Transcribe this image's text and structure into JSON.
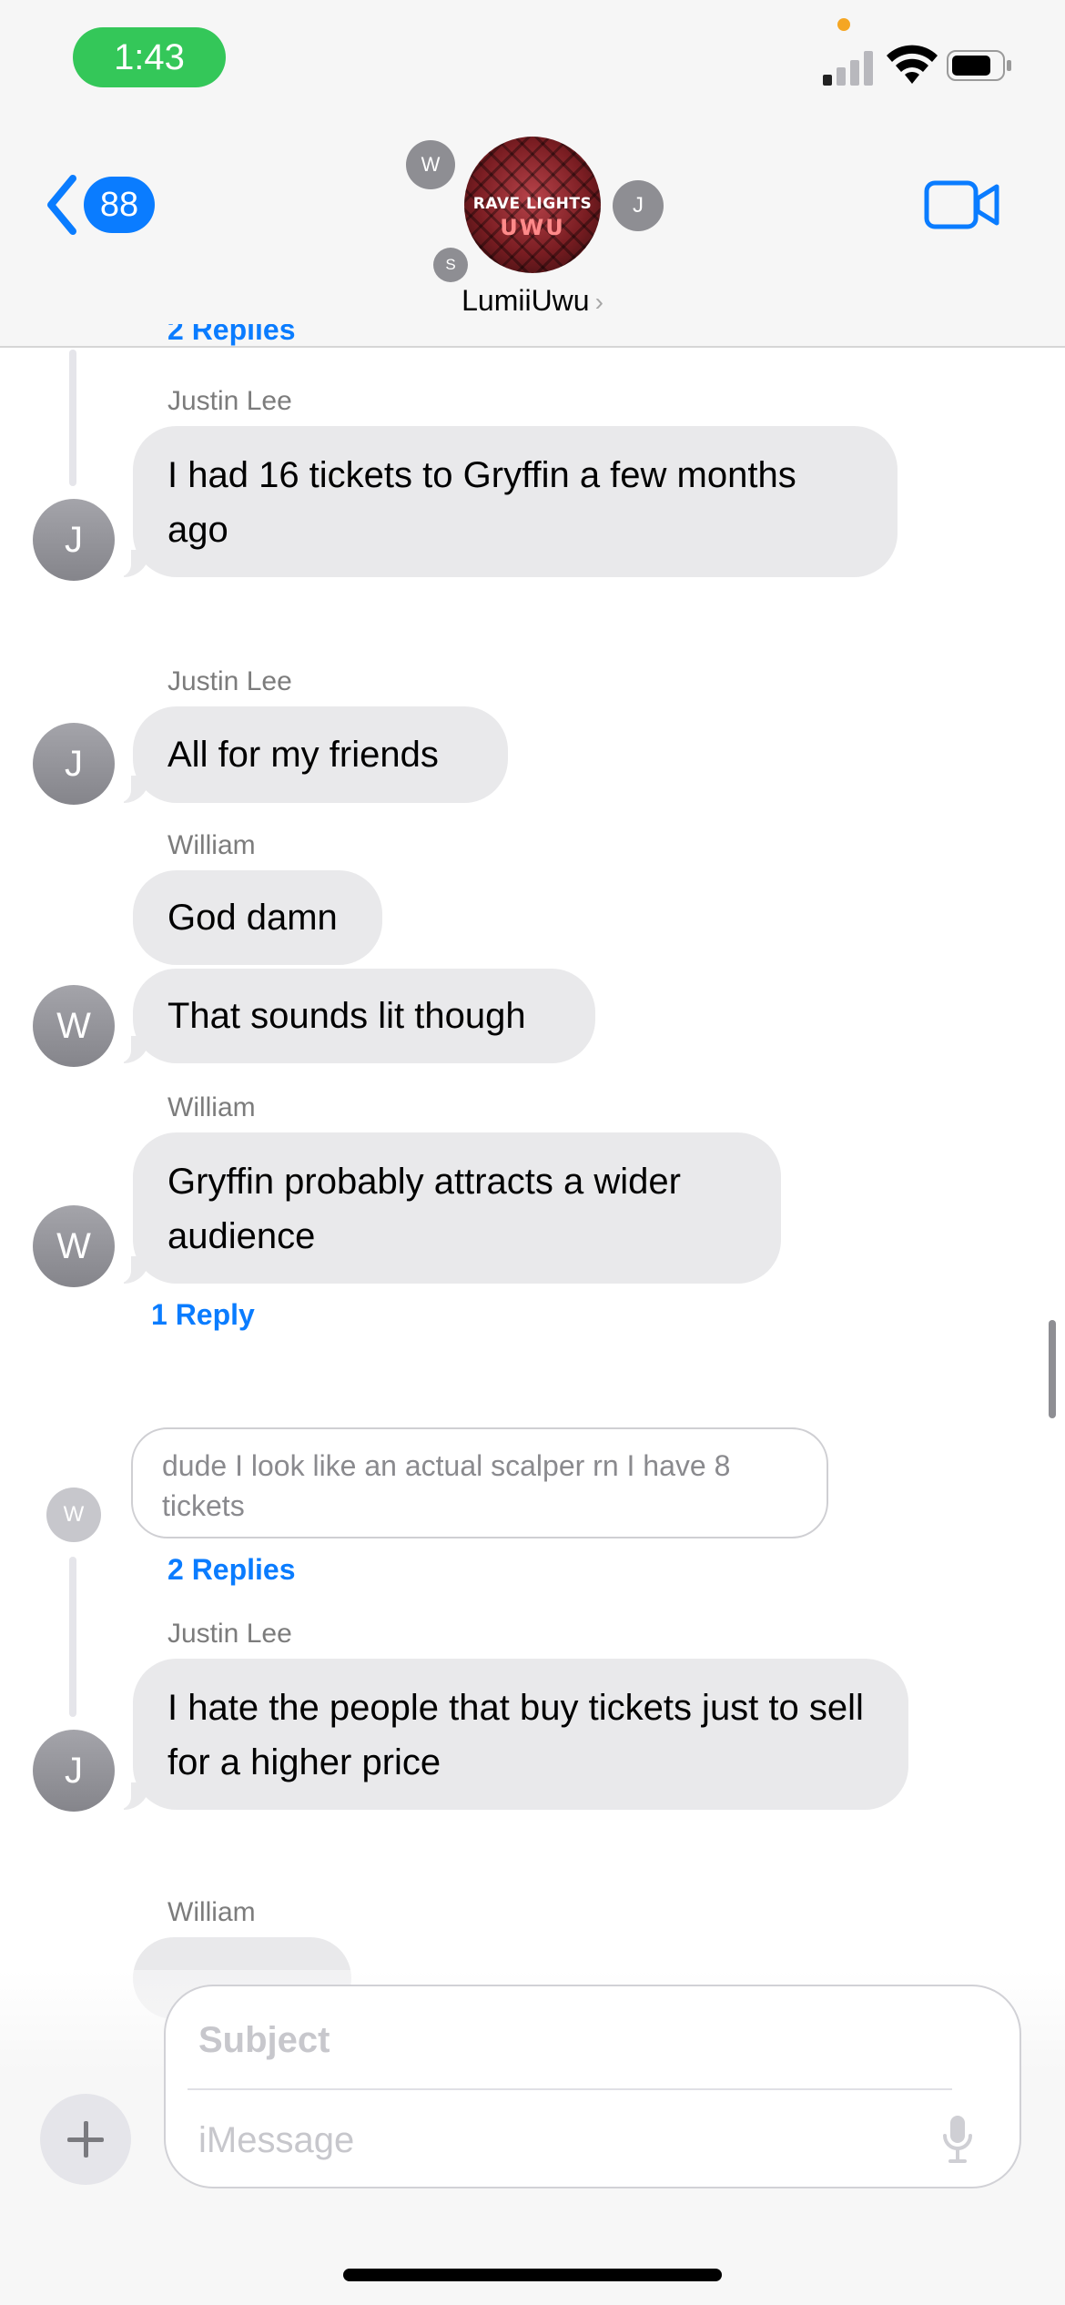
{
  "status_bar": {
    "time": "1:43"
  },
  "header": {
    "back_count": "88",
    "group_name": "LumiiUwu",
    "group_name_chevron": "›",
    "group_avatar_line1": "RAVE LIGHTS",
    "group_avatar_line2": "UWU",
    "member_initials": [
      "W",
      "J",
      "S"
    ]
  },
  "messages": {
    "partial_top_reply": "2 Replies",
    "m1": {
      "sender": "Justin Lee",
      "text": "I had 16 tickets to Gryffin a few months ago",
      "avatar": "J"
    },
    "m2": {
      "sender": "Justin Lee",
      "text": "All for my friends",
      "avatar": "J"
    },
    "m3": {
      "sender": "William",
      "text1": "God damn",
      "text2": "That sounds lit though",
      "avatar": "W"
    },
    "m4": {
      "sender": "William",
      "text": "Gryffin probably attracts a wider audience",
      "avatar": "W",
      "reply": "1 Reply"
    },
    "thread": {
      "avatar": "W",
      "text": "dude I look like an actual scalper rn I have 8 tickets",
      "reply": "2 Replies"
    },
    "m5": {
      "sender": "Justin Lee",
      "text": "I hate the people that buy tickets just to sell for a higher price",
      "avatar": "J"
    },
    "m6": {
      "sender": "William"
    }
  },
  "compose": {
    "subject_placeholder": "Subject",
    "message_placeholder": "iMessage"
  },
  "colors": {
    "accent": "#0a7cff",
    "time_pill": "#34c759",
    "bubble": "#e9e9eb"
  },
  "icons": [
    "back-chevron-icon",
    "video-camera-icon",
    "plus-icon",
    "microphone-icon",
    "wifi-icon",
    "battery-icon",
    "signal-icon"
  ]
}
